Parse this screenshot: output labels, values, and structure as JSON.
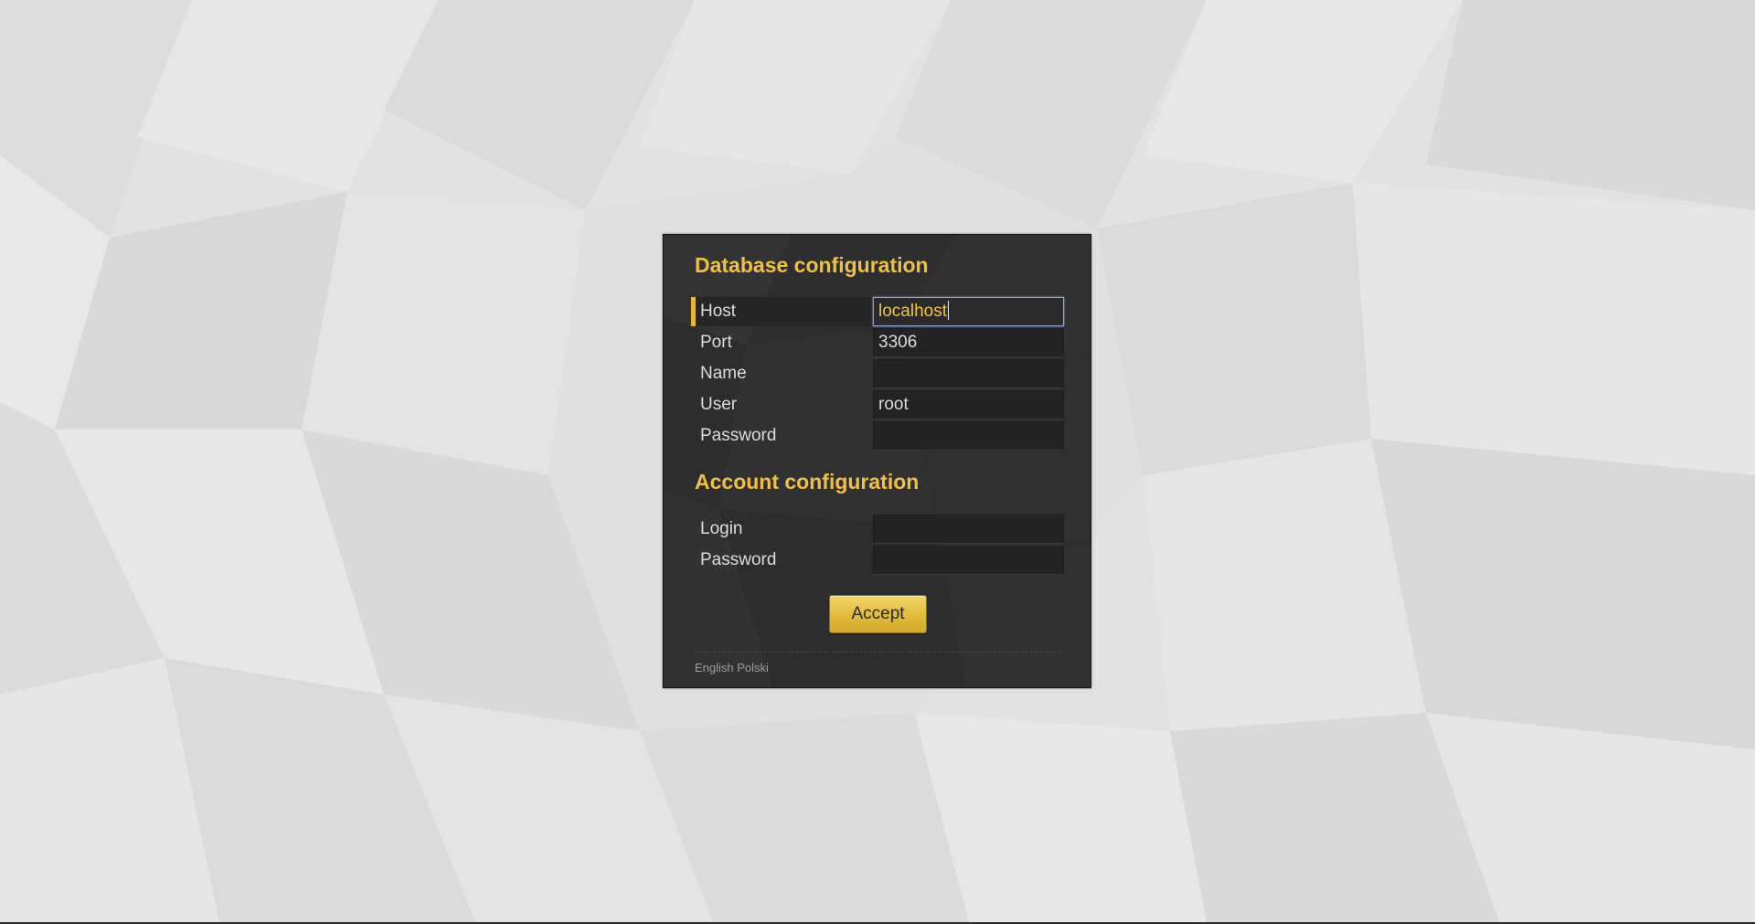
{
  "database_section": {
    "title": "Database configuration",
    "fields": [
      {
        "label": "Host",
        "value": "localhost",
        "focused": true
      },
      {
        "label": "Port",
        "value": "3306"
      },
      {
        "label": "Name",
        "value": ""
      },
      {
        "label": "User",
        "value": "root"
      },
      {
        "label": "Password",
        "value": ""
      }
    ]
  },
  "account_section": {
    "title": "Account configuration",
    "fields": [
      {
        "label": "Login",
        "value": ""
      },
      {
        "label": "Password",
        "value": ""
      }
    ]
  },
  "accept_button": {
    "label": "Accept"
  },
  "languages": [
    "English",
    "Polski"
  ],
  "colors": {
    "page_background": "#e1e2e1",
    "panel_background": "#303030",
    "accent": "#efc043",
    "button": "#e2bd3d",
    "focus_border": "#8aa6cc"
  }
}
